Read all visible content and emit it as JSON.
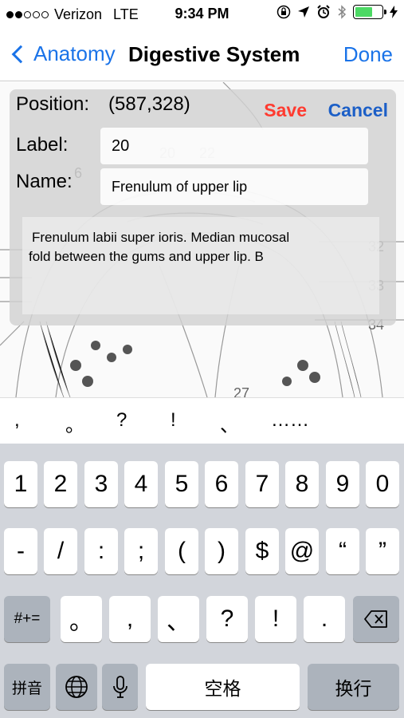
{
  "status_bar": {
    "carrier": "Verizon",
    "network": "LTE",
    "time": "9:34 PM",
    "signal_bars_filled": 2,
    "signal_bars_total": 5,
    "battery_level": 0.65
  },
  "nav": {
    "back_label": "Anatomy",
    "title": "Digestive System",
    "done_label": "Done"
  },
  "illustration": {
    "numbers": [
      "6",
      "20",
      "22",
      "32",
      "33",
      "34",
      "27"
    ]
  },
  "edit_panel": {
    "position_label": "Position:",
    "position_value": "(587,328)",
    "save_label": "Save",
    "cancel_label": "Cancel",
    "label_label": "Label:",
    "label_value": "20",
    "name_label": "Name:",
    "name_value": "Frenulum of upper lip",
    "description_lines": [
      "Frenulum labii super ioris. Median mucosal",
      "fold between the gums and upper lip. B"
    ]
  },
  "candidates": [
    ",",
    "。",
    "?",
    "!",
    "、",
    "……"
  ],
  "keyboard": {
    "row1": [
      "1",
      "2",
      "3",
      "4",
      "5",
      "6",
      "7",
      "8",
      "9",
      "0"
    ],
    "row2": [
      "-",
      "/",
      ":",
      ";",
      "(",
      ")",
      "$",
      "@",
      "“",
      "”"
    ],
    "row3": [
      "#+=",
      "。",
      ",",
      "、",
      "?",
      "!",
      "."
    ],
    "row4": [
      "拼音",
      "空格",
      "换行"
    ],
    "colors": {
      "background": "#d2d5db",
      "key": "#ffffff",
      "dark_key": "#acb3bc"
    }
  },
  "accent_colors": {
    "link_blue": "#1a73e8",
    "save_red": "#ff3b30",
    "battery_green": "#4cd964"
  }
}
